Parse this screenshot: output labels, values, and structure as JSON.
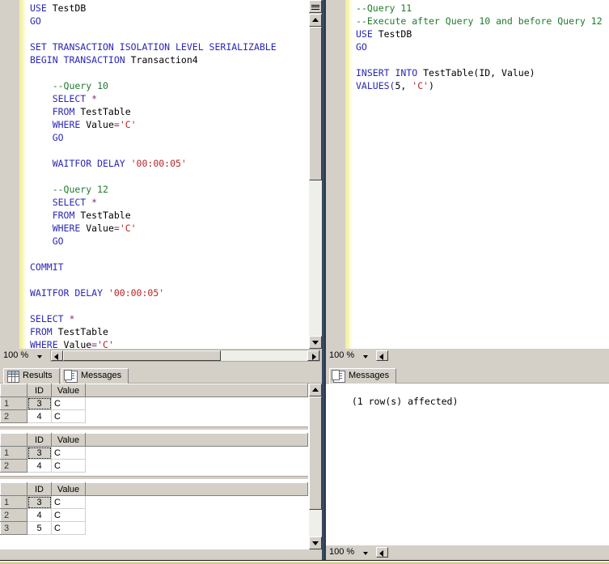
{
  "left_pane": {
    "editor": {
      "lines": [
        [
          {
            "t": "USE ",
            "c": "kw"
          },
          {
            "t": "TestDB",
            "c": "tx"
          }
        ],
        [
          {
            "t": "GO",
            "c": "kw"
          }
        ],
        [],
        [
          {
            "t": "SET TRANSACTION ISOLATION LEVEL SERIALIZABLE",
            "c": "kw"
          }
        ],
        [
          {
            "t": "BEGIN TRANSACTION ",
            "c": "kw"
          },
          {
            "t": "Transaction4",
            "c": "tx"
          }
        ],
        [],
        [
          {
            "t": "    --Query 10",
            "c": "cmt"
          }
        ],
        [
          {
            "t": "    SELECT ",
            "c": "kw"
          },
          {
            "t": "*",
            "c": "op"
          }
        ],
        [
          {
            "t": "    FROM ",
            "c": "kw"
          },
          {
            "t": "TestTable",
            "c": "tx"
          }
        ],
        [
          {
            "t": "    WHERE ",
            "c": "kw"
          },
          {
            "t": "Value",
            "c": "tx"
          },
          {
            "t": "=",
            "c": "op"
          },
          {
            "t": "'C'",
            "c": "str"
          }
        ],
        [
          {
            "t": "    GO",
            "c": "kw"
          }
        ],
        [],
        [
          {
            "t": "    WAITFOR DELAY ",
            "c": "kw"
          },
          {
            "t": "'00:00:05'",
            "c": "str"
          }
        ],
        [],
        [
          {
            "t": "    --Query 12",
            "c": "cmt"
          }
        ],
        [
          {
            "t": "    SELECT ",
            "c": "kw"
          },
          {
            "t": "*",
            "c": "op"
          }
        ],
        [
          {
            "t": "    FROM ",
            "c": "kw"
          },
          {
            "t": "TestTable",
            "c": "tx"
          }
        ],
        [
          {
            "t": "    WHERE ",
            "c": "kw"
          },
          {
            "t": "Value",
            "c": "tx"
          },
          {
            "t": "=",
            "c": "op"
          },
          {
            "t": "'C'",
            "c": "str"
          }
        ],
        [
          {
            "t": "    GO",
            "c": "kw"
          }
        ],
        [],
        [
          {
            "t": "COMMIT",
            "c": "kw"
          }
        ],
        [],
        [
          {
            "t": "WAITFOR DELAY ",
            "c": "kw"
          },
          {
            "t": "'00:00:05'",
            "c": "str"
          }
        ],
        [],
        [
          {
            "t": "SELECT ",
            "c": "kw"
          },
          {
            "t": "*",
            "c": "op"
          }
        ],
        [
          {
            "t": "FROM ",
            "c": "kw"
          },
          {
            "t": "TestTable",
            "c": "tx"
          }
        ],
        [
          {
            "t": "WHERE ",
            "c": "kw"
          },
          {
            "t": "Value",
            "c": "tx"
          },
          {
            "t": "=",
            "c": "op"
          },
          {
            "t": "'C'",
            "c": "str"
          }
        ]
      ]
    },
    "zoom_value": "100 %",
    "tabs": [
      {
        "label": "Results",
        "icon": "grid-icon",
        "selected": true
      },
      {
        "label": "Messages",
        "icon": "messages-icon",
        "selected": false
      }
    ],
    "grids": [
      {
        "columns": [
          "",
          "ID",
          "Value"
        ],
        "rows": [
          {
            "n": "1",
            "ID": "3",
            "Value": "C",
            "selected": true
          },
          {
            "n": "2",
            "ID": "4",
            "Value": "C",
            "selected": false
          }
        ]
      },
      {
        "columns": [
          "",
          "ID",
          "Value"
        ],
        "rows": [
          {
            "n": "1",
            "ID": "3",
            "Value": "C",
            "selected": true
          },
          {
            "n": "2",
            "ID": "4",
            "Value": "C",
            "selected": false
          }
        ]
      },
      {
        "columns": [
          "",
          "ID",
          "Value"
        ],
        "rows": [
          {
            "n": "1",
            "ID": "3",
            "Value": "C",
            "selected": true
          },
          {
            "n": "2",
            "ID": "4",
            "Value": "C",
            "selected": false
          },
          {
            "n": "3",
            "ID": "5",
            "Value": "C",
            "selected": false
          }
        ]
      }
    ]
  },
  "right_pane": {
    "editor": {
      "lines": [
        [
          {
            "t": "--Query 11",
            "c": "cmt"
          }
        ],
        [
          {
            "t": "--Execute after Query 10 and before Query 12",
            "c": "cmt"
          }
        ],
        [
          {
            "t": "USE ",
            "c": "kw"
          },
          {
            "t": "TestDB",
            "c": "tx"
          }
        ],
        [
          {
            "t": "GO",
            "c": "kw"
          }
        ],
        [],
        [
          {
            "t": "INSERT INTO ",
            "c": "kw"
          },
          {
            "t": "TestTable(ID, Value)",
            "c": "tx"
          }
        ],
        [
          {
            "t": "VALUES(",
            "c": "kw"
          },
          {
            "t": "5",
            "c": "tx"
          },
          {
            "t": ", ",
            "c": "tx"
          },
          {
            "t": "'C'",
            "c": "str"
          },
          {
            "t": ")",
            "c": "tx"
          }
        ]
      ]
    },
    "zoom_value_top": "100 %",
    "zoom_value_bottom": "100 %",
    "tabs": [
      {
        "label": "Messages",
        "icon": "messages-icon",
        "selected": true
      }
    ],
    "message_text": "  (1 row(s) affected)"
  },
  "colors": {
    "keyword": "#2a27b5",
    "comment": "#1f7a2e",
    "string": "#b82323",
    "operator": "#7a3070",
    "chrome": "#d4d0c8",
    "divider": "#2e3d54",
    "change_bar": "#f2ef9e"
  }
}
